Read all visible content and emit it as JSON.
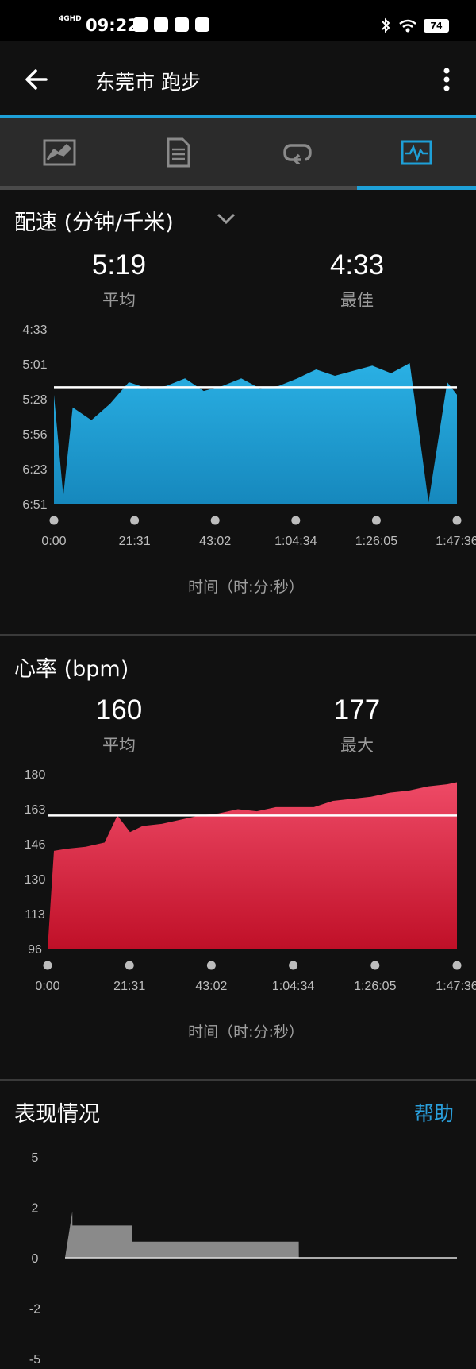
{
  "status_bar": {
    "time": "09:22",
    "network": "4GHD",
    "battery": "74"
  },
  "header": {
    "title": "东莞市 跑步"
  },
  "tabs": [
    {
      "name": "overview-tab"
    },
    {
      "name": "details-tab"
    },
    {
      "name": "laps-tab"
    },
    {
      "name": "charts-tab",
      "selected": true
    }
  ],
  "pace": {
    "title": "配速 (分钟/千米)",
    "avg_value": "5:19",
    "avg_label": "平均",
    "best_value": "4:33",
    "best_label": "最佳",
    "axis_title": "时间（时:分:秒）"
  },
  "heart_rate": {
    "title": "心率 (bpm)",
    "avg_value": "160",
    "avg_label": "平均",
    "max_value": "177",
    "max_label": "最大",
    "axis_title": "时间（时:分:秒）"
  },
  "performance": {
    "title": "表现情况",
    "help_label": "帮助"
  },
  "colors": {
    "accent": "#1ea0d8",
    "pace_fill": "#1aa3d6",
    "hr_fill": "#e03a56",
    "perf_fill": "#8a8a8a"
  },
  "chart_data": [
    {
      "type": "area",
      "title": "配速 (分钟/千米)",
      "xlabel": "时间（时:分:秒）",
      "x_ticks": [
        "0:00",
        "21:31",
        "43:02",
        "1:04:34",
        "1:26:05",
        "1:47:36"
      ],
      "y_ticks": [
        "4:33",
        "5:01",
        "5:28",
        "5:56",
        "6:23",
        "6:51"
      ],
      "y_range_sec": [
        273,
        411
      ],
      "y_inverted": true,
      "average_sec": 319,
      "series": [
        {
          "x_sec": [
            0,
            150,
            300,
            600,
            900,
            1200,
            1500,
            1800,
            2100,
            2400,
            2700,
            3000,
            3300,
            3600,
            3900,
            4200,
            4500,
            4800,
            5100,
            5400,
            5700,
            6000,
            6300,
            6456
          ],
          "y_sec": [
            325,
            405,
            335,
            345,
            332,
            315,
            320,
            318,
            312,
            322,
            318,
            312,
            320,
            318,
            312,
            305,
            310,
            306,
            302,
            308,
            300,
            410,
            315,
            325
          ]
        }
      ]
    },
    {
      "type": "area",
      "title": "心率 (bpm)",
      "xlabel": "时间（时:分:秒）",
      "x_ticks": [
        "0:00",
        "21:31",
        "43:02",
        "1:04:34",
        "1:26:05",
        "1:47:36"
      ],
      "y_ticks": [
        "180",
        "163",
        "146",
        "130",
        "113",
        "96"
      ],
      "ylim": [
        96,
        180
      ],
      "average": 160,
      "series": [
        {
          "x_sec": [
            0,
            100,
            300,
            600,
            900,
            1100,
            1300,
            1500,
            1800,
            2100,
            2400,
            2700,
            3000,
            3300,
            3600,
            3900,
            4200,
            4500,
            4800,
            5100,
            5400,
            5700,
            6000,
            6300,
            6456
          ],
          "y": [
            96,
            143,
            144,
            145,
            147,
            160,
            152,
            155,
            156,
            158,
            160,
            161,
            163,
            162,
            164,
            164,
            164,
            167,
            168,
            169,
            171,
            172,
            174,
            175,
            176
          ]
        }
      ]
    },
    {
      "type": "area",
      "title": "表现情况",
      "y_ticks": [
        "5",
        "2",
        "0",
        "-2",
        "-5"
      ],
      "ylim": [
        -5,
        5
      ],
      "series": [
        {
          "x_sec": [
            0,
            120,
            121,
            1100,
            1101,
            3850,
            3851
          ],
          "y": [
            0,
            2.3,
            1.6,
            1.6,
            0.8,
            0.8,
            0
          ]
        }
      ]
    }
  ]
}
